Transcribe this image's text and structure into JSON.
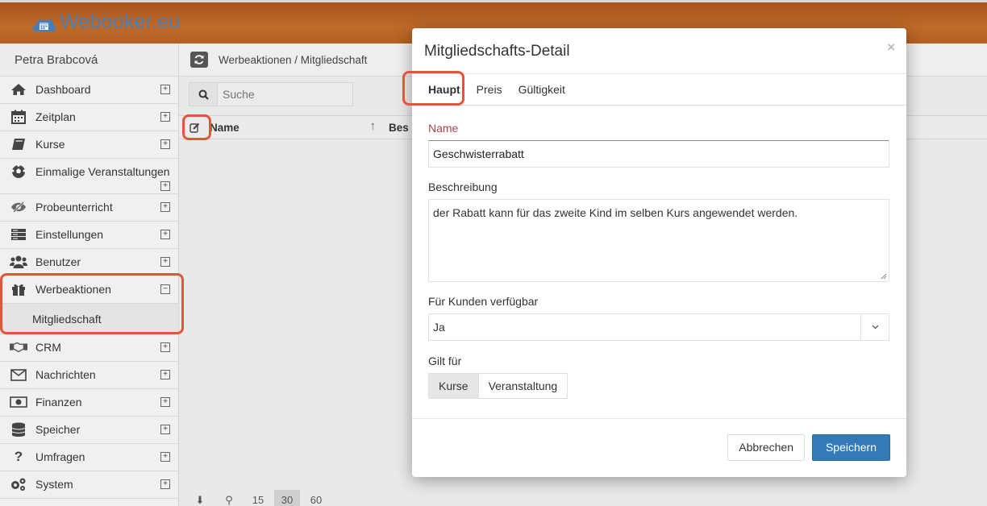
{
  "brand": {
    "name": "Webooker.eu"
  },
  "user": {
    "name": "Petra Brabcová"
  },
  "sidebar": {
    "items": [
      {
        "label": "Dashboard",
        "icon": "home-icon",
        "toggle": "⊞"
      },
      {
        "label": "Zeitplan",
        "icon": "calendar-icon",
        "toggle": "⊞"
      },
      {
        "label": "Kurse",
        "icon": "book-icon",
        "toggle": "⊞"
      },
      {
        "label": "Einmalige Veranstaltungen",
        "icon": "soccer-ball-icon",
        "toggle": "⊞"
      },
      {
        "label": "Probeunterricht",
        "icon": "eye-slash-icon",
        "toggle": "⊞"
      },
      {
        "label": "Einstellungen",
        "icon": "server-icon",
        "toggle": "⊞"
      },
      {
        "label": "Benutzer",
        "icon": "users-icon",
        "toggle": "⊞"
      },
      {
        "label": "Werbeaktionen",
        "icon": "gift-icon",
        "toggle": "⊟"
      },
      {
        "label": "CRM",
        "icon": "handshake-icon",
        "toggle": "⊞"
      },
      {
        "label": "Nachrichten",
        "icon": "envelope-icon",
        "toggle": "⊞"
      },
      {
        "label": "Finanzen",
        "icon": "money-icon",
        "toggle": "⊞"
      },
      {
        "label": "Speicher",
        "icon": "database-icon",
        "toggle": "⊞"
      },
      {
        "label": "Umfragen",
        "icon": "question-icon",
        "toggle": "⊞"
      },
      {
        "label": "System",
        "icon": "cogs-icon",
        "toggle": "⊞"
      }
    ],
    "sub_item": "Mitgliedschaft"
  },
  "main": {
    "breadcrumb": "Werbeaktionen / Mitgliedschaft",
    "search_placeholder": "Suche",
    "col_name": "Name",
    "col_next": "Bes",
    "sort_arrow": "↑",
    "pager": [
      "⬇",
      "⚲",
      "15",
      "30",
      "60"
    ]
  },
  "modal": {
    "title": "Mitgliedschafts-Detail",
    "close": "×",
    "tabs": [
      "Haupt",
      "Preis",
      "Gültigkeit"
    ],
    "name_label": "Name",
    "name_value": "Geschwisterrabatt",
    "desc_label": "Beschreibung",
    "desc_value": "der Rabatt kann für das zweite Kind im selben Kurs angewendet werden.",
    "available_label": "Für Kunden verfügbar",
    "available_value": "Ja",
    "applies_label": "Gilt für",
    "applies_options": [
      "Kurse",
      "Veranstaltung"
    ],
    "cancel": "Abbrechen",
    "save": "Speichern"
  },
  "colors": {
    "header": "#b85f22",
    "accent": "#337ab7",
    "highlight": "#e4533a",
    "error_label": "#a94442"
  }
}
